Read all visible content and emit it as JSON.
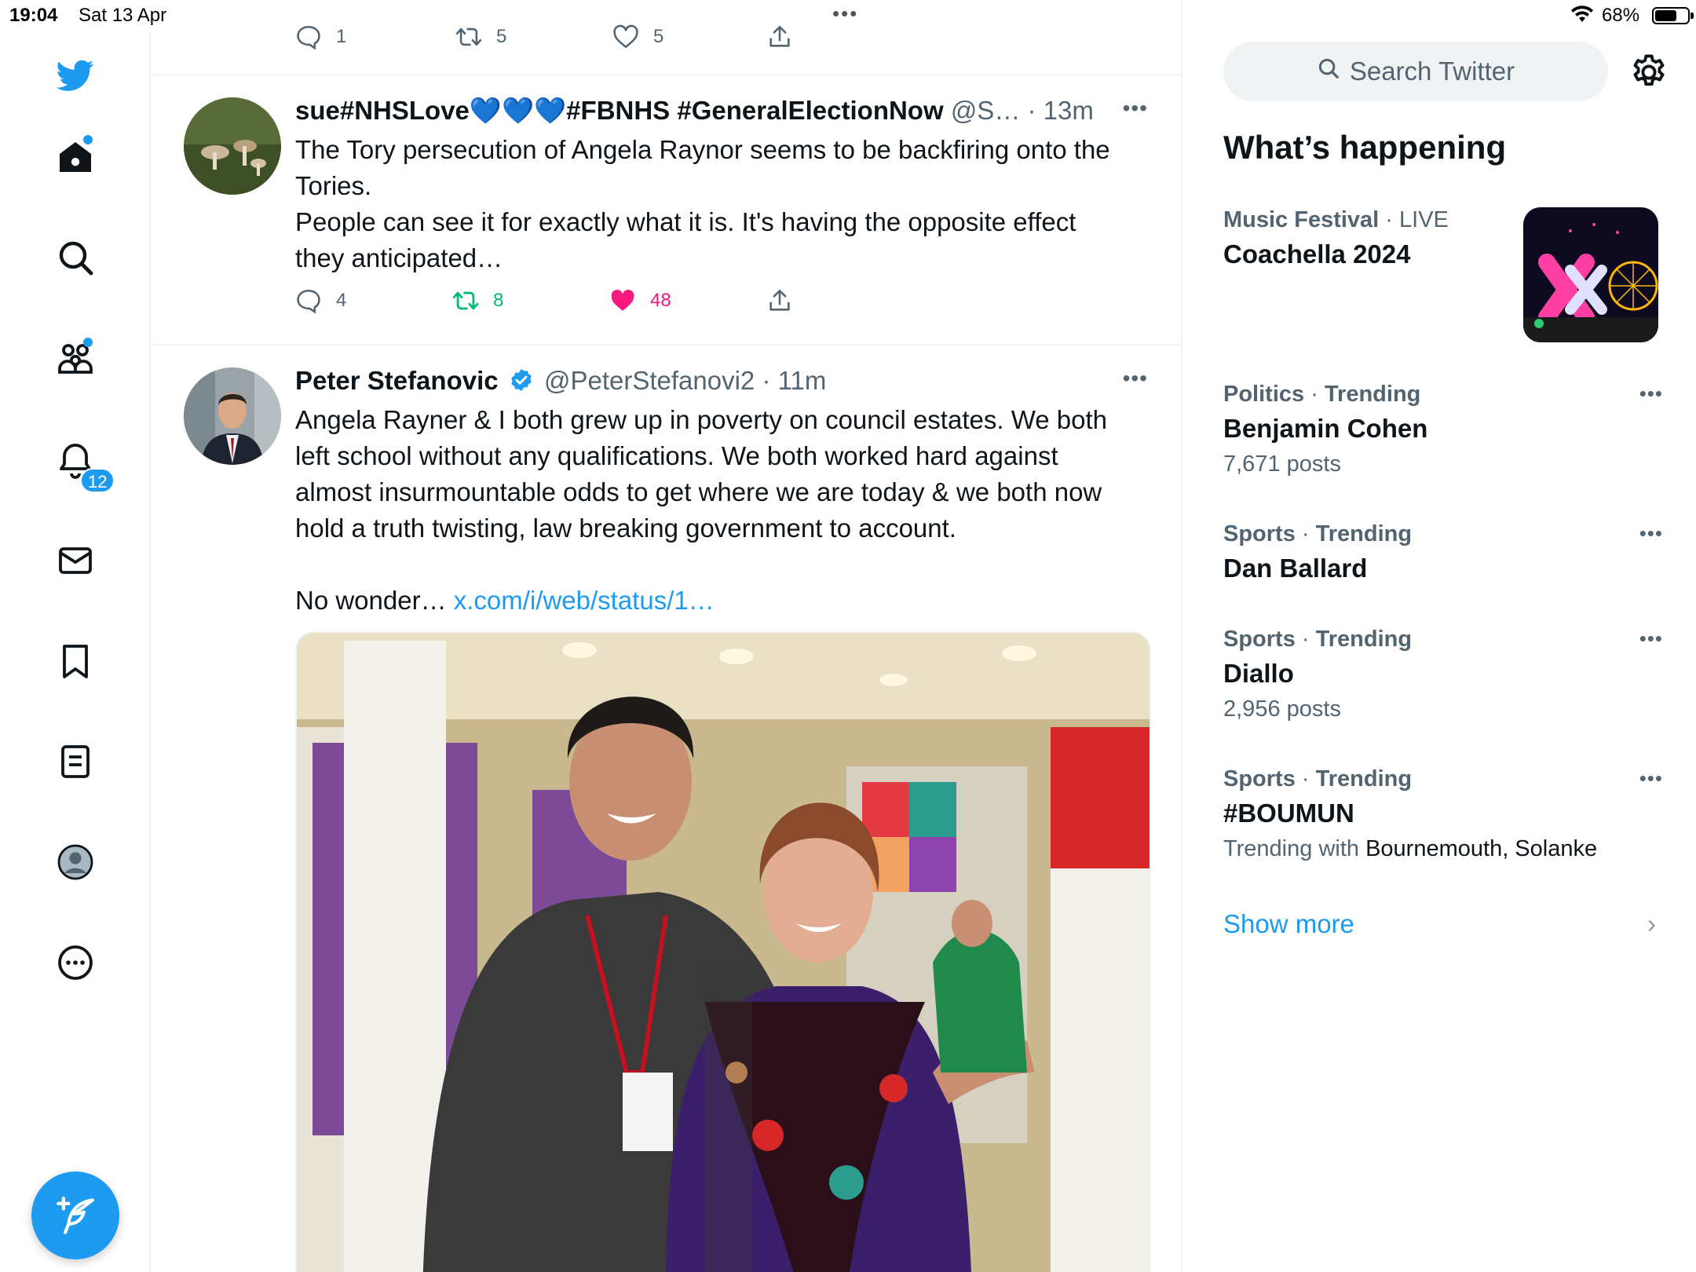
{
  "status_bar": {
    "time": "19:04",
    "date": "Sat 13 Apr",
    "multitask": "•••",
    "battery_pct": "68%",
    "battery_level": 0.68
  },
  "sidebar": {
    "items": [
      "logo",
      "home",
      "explore",
      "communities",
      "notifications",
      "messages",
      "bookmarks",
      "lists",
      "profile",
      "more"
    ],
    "notification_count": "12",
    "accent": "#1d9bf0"
  },
  "partial_tweet": {
    "replies": "1",
    "retweets": "5",
    "likes": "5"
  },
  "tweets": [
    {
      "name": "sue#NHSLove💙💙💙#FBNHS #GeneralElectionNow",
      "handle": "@S…",
      "time": "· 13m",
      "lines": [
        "The Tory persecution of Angela Raynor seems to be backfiring onto the",
        "Tories.",
        "People can see it for exactly what it is. It's having the opposite effect",
        "they anticipated…"
      ],
      "replies": "4",
      "retweets": "8",
      "likes": "48",
      "liked": true,
      "retweet_color": "#00ba7c",
      "like_color": "#f91880"
    },
    {
      "name": "Peter Stefanovic",
      "handle": "@PeterStefanovi2",
      "time": "· 11m",
      "verified": true,
      "lines": [
        "Angela Rayner & I both grew up in poverty on council estates. We both",
        "left school without any qualifications. We both worked hard against",
        "almost insurmountable odds to get where we are today & we both now",
        "hold a truth twisting, law breaking government to account."
      ],
      "tail_text": "No wonder…",
      "tail_link": "x.com/i/web/status/1…"
    }
  ],
  "right": {
    "search_placeholder": "Search Twitter",
    "section_title": "What’s happening",
    "trends": [
      {
        "category": "Music Festival",
        "sep": " · ",
        "status": "LIVE",
        "name": "Coachella 2024"
      },
      {
        "category": "Politics",
        "sep": " · ",
        "status": "Trending",
        "name": "Benjamin Cohen",
        "count": "7,671 posts"
      },
      {
        "category": "Sports",
        "sep": " · ",
        "status": "Trending",
        "name": "Dan Ballard"
      },
      {
        "category": "Sports",
        "sep": " · ",
        "status": "Trending",
        "name": "Diallo",
        "count": "2,956 posts"
      },
      {
        "category": "Sports",
        "sep": " · ",
        "status": "Trending",
        "name": "#BOUMUN",
        "with_prefix": "Trending with ",
        "with_names": "Bournemouth, Solanke"
      }
    ],
    "show_more": "Show more",
    "more_glyph": "•••",
    "chevron": "›"
  }
}
